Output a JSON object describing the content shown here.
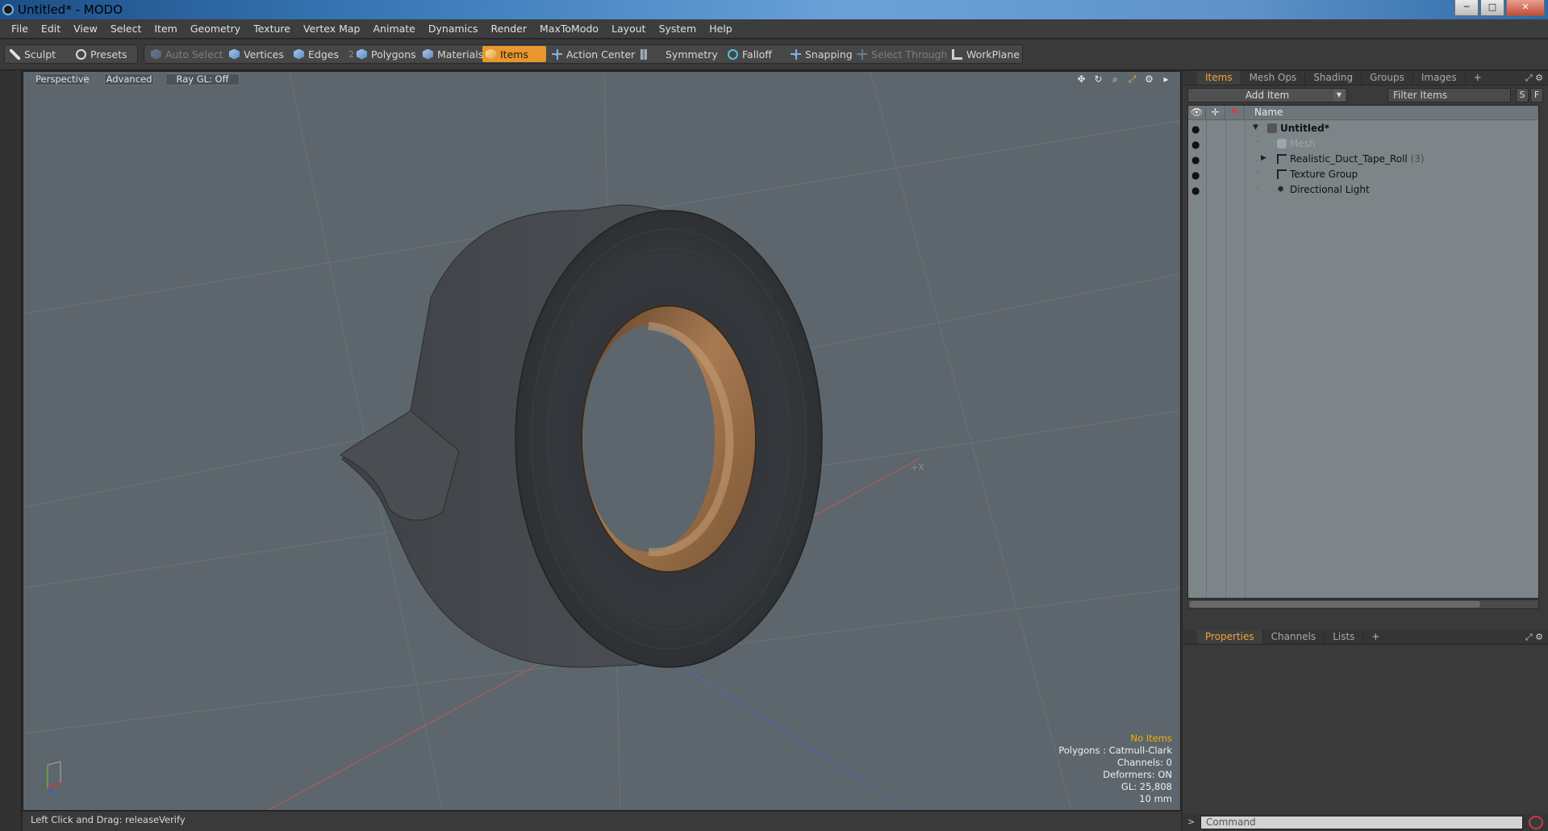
{
  "window": {
    "title": "Untitled* - MODO",
    "buttons": {
      "minimize": "─",
      "maximize": "□",
      "close": "✕"
    }
  },
  "menubar": [
    "File",
    "Edit",
    "View",
    "Select",
    "Item",
    "Geometry",
    "Texture",
    "Vertex Map",
    "Animate",
    "Dynamics",
    "Render",
    "MaxToModo",
    "Layout",
    "System",
    "Help"
  ],
  "toolbar": {
    "sculpt": "Sculpt",
    "presets": "Presets",
    "auto_select": "Auto Select",
    "vertices": "Vertices",
    "edges": "Edges",
    "edges_count": "2",
    "polygons": "Polygons",
    "materials": "Materials",
    "items": "Items",
    "action_center": "Action Center",
    "symmetry": "Symmetry",
    "falloff": "Falloff",
    "snapping": "Snapping",
    "select_through": "Select Through",
    "workplane": "WorkPlane"
  },
  "viewport": {
    "tab_perspective": "Perspective",
    "tab_advanced": "Advanced",
    "tab_raygl": "Ray GL: Off",
    "info": {
      "no_items": "No Items",
      "polygons": "Polygons : Catmull-Clark",
      "channels": "Channels: 0",
      "deformers": "Deformers: ON",
      "gl": "GL: 25,808",
      "scale": "10 mm"
    },
    "axis_label": "+X"
  },
  "statusbar": {
    "text": "Left Click and Drag:  releaseVerify"
  },
  "items_panel": {
    "tabs": [
      "Items",
      "Mesh Ops",
      "Shading",
      "Groups",
      "Images",
      "+"
    ],
    "active_tab": "Items",
    "add_item": "Add Item",
    "filter_placeholder": "Filter Items",
    "btn_s": "S",
    "btn_f": "F",
    "column_name": "Name",
    "rows": [
      {
        "label": "Untitled*",
        "count": "",
        "icon": "scene-icon"
      },
      {
        "label": "Mesh",
        "count": "",
        "icon": "mesh-icon"
      },
      {
        "label": "Realistic_Duct_Tape_Roll",
        "count": "(3)",
        "icon": "group-icon"
      },
      {
        "label": "Texture Group",
        "count": "",
        "icon": "group-icon"
      },
      {
        "label": "Directional Light",
        "count": "",
        "icon": "light-icon"
      }
    ]
  },
  "properties_panel": {
    "tabs": [
      "Properties",
      "Channels",
      "Lists",
      "+"
    ],
    "active_tab": "Properties"
  },
  "command": {
    "placeholder": "Command",
    "prompt": ">"
  },
  "colors": {
    "accent": "#e8962d",
    "viewport_bg": "#5d666c",
    "tree_bg": "#7d8589",
    "info_highlight": "#f5b000"
  }
}
